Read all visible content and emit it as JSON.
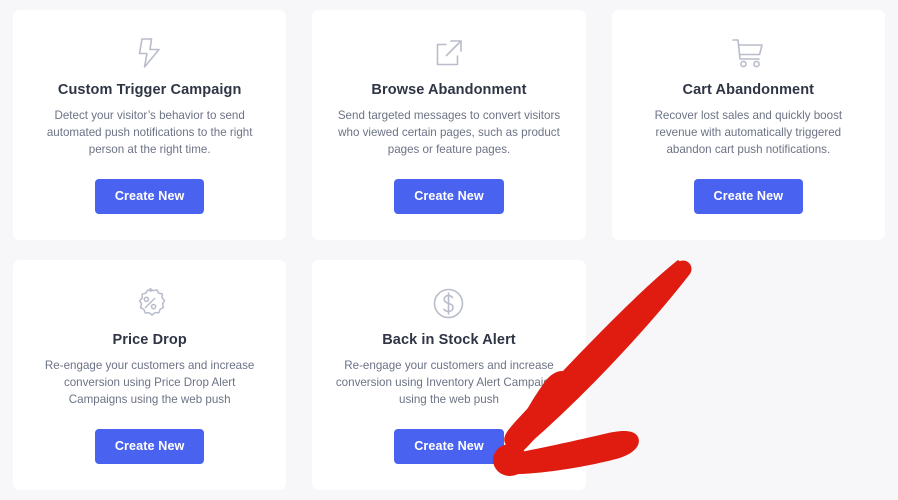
{
  "page": {
    "background_color": "#f7f7f9",
    "card_background_color": "#ffffff",
    "button_color": "#4a62f0",
    "title_color": "#2f3545",
    "description_color": "#6c7385",
    "icon_color": "#b9bcca",
    "annotation_color": "#e01b10"
  },
  "cards": [
    {
      "icon": "lightning-bolt-icon",
      "title": "Custom Trigger Campaign",
      "description": "Detect your visitor’s behavior to send automated push notifications to the right person at the right time.",
      "button_label": "Create New"
    },
    {
      "icon": "external-link-icon",
      "title": "Browse Abandonment",
      "description": "Send targeted messages to convert visitors who viewed certain pages, such as product pages or feature pages.",
      "button_label": "Create New"
    },
    {
      "icon": "shopping-cart-icon",
      "title": "Cart Abandonment",
      "description": "Recover lost sales and quickly boost revenue with automatically triggered abandon cart push notifications.",
      "button_label": "Create New"
    },
    {
      "icon": "percent-badge-icon",
      "title": "Price Drop",
      "description": "Re-engage your customers and increase conversion using Price Drop Alert Campaigns using the web push",
      "button_label": "Create New"
    },
    {
      "icon": "dollar-circle-icon",
      "title": "Back in Stock Alert",
      "description": "Re-engage your customers and increase conversion using Inventory Alert Campaigns using the web push",
      "button_label": "Create New"
    }
  ],
  "annotation": {
    "type": "red-arrow",
    "points_to": "Create New button of Back in Stock Alert card",
    "color": "#e01b10"
  }
}
